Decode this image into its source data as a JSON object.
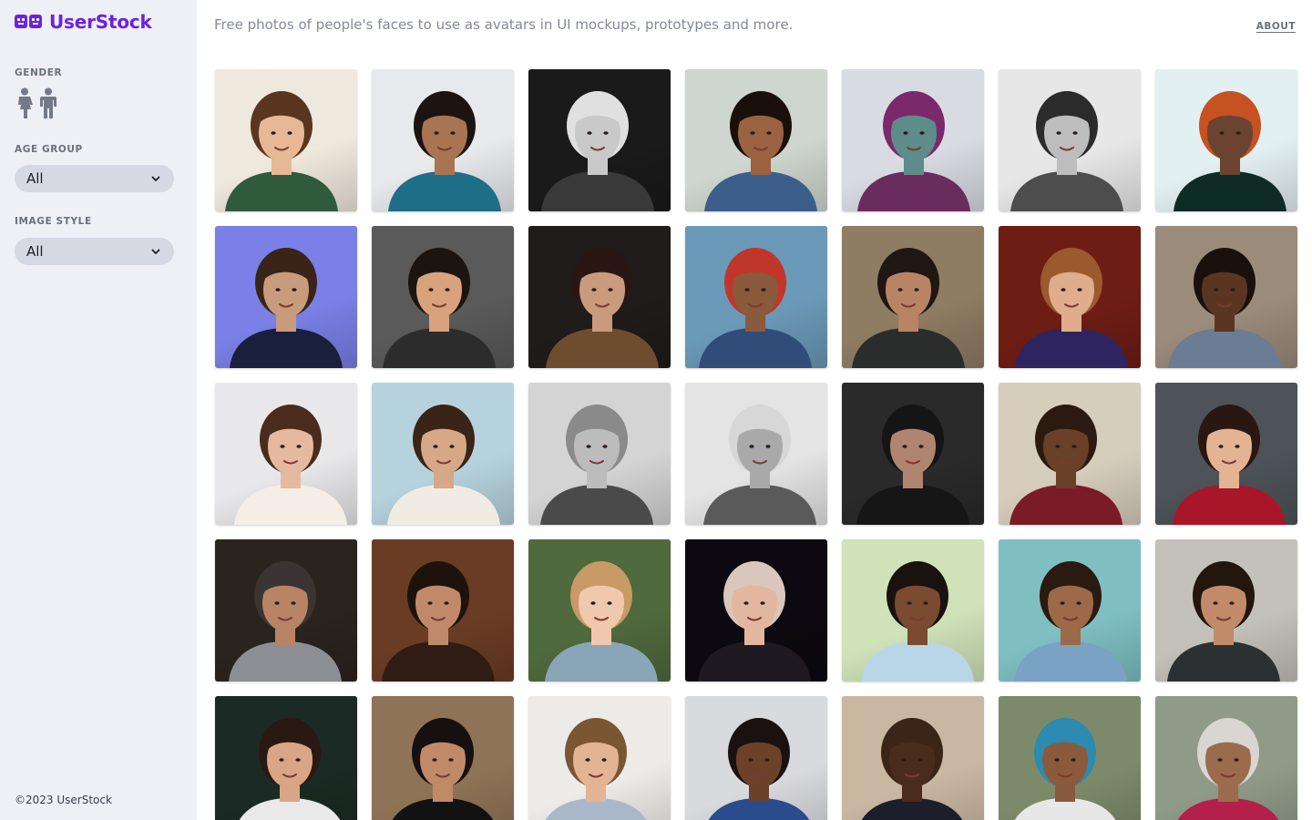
{
  "brand": {
    "name": "UserStock",
    "accent": "#6c22e0",
    "icon": "robot-logo-icon"
  },
  "header": {
    "tagline": "Free photos of people's faces to use as avatars in UI mockups, prototypes and more.",
    "about_link": "ABOUT"
  },
  "sidebar": {
    "gender_label": "GENDER",
    "gender_icons": [
      "female-person-icon",
      "male-person-icon"
    ],
    "age_group_label": "AGE GROUP",
    "age_group_value": "All",
    "image_style_label": "IMAGE STYLE",
    "image_style_value": "All",
    "footer": "©2023 UserStock"
  },
  "colors": {
    "sidebar_bg": "#eef0f6",
    "select_bg": "#d6d9e3",
    "muted_text": "#868a95"
  },
  "photos": [
    {
      "bg": "#efe8dd",
      "skin": "#e7b895",
      "hair": "#5a3520",
      "shirt": "#2f5a3c"
    },
    {
      "bg": "#e8e9ec",
      "skin": "#a87452",
      "hair": "#1c1410",
      "shirt": "#1f6e88"
    },
    {
      "bg": "#1a1a1a",
      "skin": "#c9c9c9",
      "hair": "#e0e0e0",
      "shirt": "#3a3a3a"
    },
    {
      "bg": "#cfd5cf",
      "skin": "#9a6241",
      "hair": "#1a100b",
      "shirt": "#3b5f8a"
    },
    {
      "bg": "#d9dbe3",
      "skin": "#5e8c8a",
      "hair": "#7a2a6a",
      "shirt": "#6a2c5d"
    },
    {
      "bg": "#e7e7e7",
      "skin": "#bdbdbd",
      "hair": "#2b2b2b",
      "shirt": "#4d4d4d"
    },
    {
      "bg": "#e3f0f2",
      "skin": "#6a4430",
      "hair": "#c65222",
      "shirt": "#0f2b26"
    },
    {
      "bg": "#7a80e6",
      "skin": "#c99b7d",
      "hair": "#3a2418",
      "shirt": "#18203c"
    },
    {
      "bg": "#5a5a5a",
      "skin": "#d8a27c",
      "hair": "#1b1512",
      "shirt": "#2c2c2c"
    },
    {
      "bg": "#1f1c1b",
      "skin": "#c99a7c",
      "hair": "#2a1713",
      "shirt": "#6e4d2f"
    },
    {
      "bg": "#6b99b8",
      "skin": "#8a5a3c",
      "hair": "#c0362b",
      "shirt": "#2f4d78"
    },
    {
      "bg": "#8e7c63",
      "skin": "#b88463",
      "hair": "#201612",
      "shirt": "#2a2d2c"
    },
    {
      "bg": "#6e1d14",
      "skin": "#dfac8c",
      "hair": "#9a5a2e",
      "shirt": "#2e2560"
    },
    {
      "bg": "#9b8b7b",
      "skin": "#5a3622",
      "hair": "#1a110c",
      "shirt": "#6b7d94"
    },
    {
      "bg": "#e8e8ea",
      "skin": "#e5b9a0",
      "hair": "#4a2c1d",
      "shirt": "#f4eee6"
    },
    {
      "bg": "#b6d3dd",
      "skin": "#d6a886",
      "hair": "#3a2418",
      "shirt": "#f1ece3"
    },
    {
      "bg": "#d4d4d4",
      "skin": "#bcbcbc",
      "hair": "#8a8a8a",
      "shirt": "#4a4a4a"
    },
    {
      "bg": "#e4e4e4",
      "skin": "#a9a9a9",
      "hair": "#d7d7d7",
      "shirt": "#5a5a5a"
    },
    {
      "bg": "#2a2a2a",
      "skin": "#b08570",
      "hair": "#151515",
      "shirt": "#161616"
    },
    {
      "bg": "#d7cdbd",
      "skin": "#6a4028",
      "hair": "#2a1a10",
      "shirt": "#7a1b27"
    },
    {
      "bg": "#4d5358",
      "skin": "#e3b393",
      "hair": "#2b1711",
      "shirt": "#a9162a"
    },
    {
      "bg": "#2a241f",
      "skin": "#b88465",
      "hair": "#3a3533",
      "shirt": "#8c8e93"
    },
    {
      "bg": "#6a3c24",
      "skin": "#c08a6a",
      "hair": "#1e120c",
      "shirt": "#2f1c14"
    },
    {
      "bg": "#4f6a3c",
      "skin": "#f0c8ae",
      "hair": "#c79a66",
      "shirt": "#8aa4b8"
    },
    {
      "bg": "#0c0a10",
      "skin": "#e3b6a0",
      "hair": "#d9c7bd",
      "shirt": "#1f1a22"
    },
    {
      "bg": "#cfe2b8",
      "skin": "#7a4b30",
      "hair": "#1a120e",
      "shirt": "#b9d6e8"
    },
    {
      "bg": "#7fbfc2",
      "skin": "#9c6a48",
      "hair": "#2a1a10",
      "shirt": "#7aa2c2"
    },
    {
      "bg": "#c3c1b9",
      "skin": "#c18b69",
      "hair": "#22160f",
      "shirt": "#2d3032"
    },
    {
      "bg": "#1b2a24",
      "skin": "#d8a685",
      "hair": "#2a1813",
      "shirt": "#e9e9e9"
    },
    {
      "bg": "#8f7356",
      "skin": "#c08a68",
      "hair": "#161010",
      "shirt": "#121212"
    },
    {
      "bg": "#ecebe8",
      "skin": "#e2b494",
      "hair": "#7a5632",
      "shirt": "#aab7c8"
    },
    {
      "bg": "#d8dadd",
      "skin": "#6b4129",
      "hair": "#1a1210",
      "shirt": "#2a4c8c"
    },
    {
      "bg": "#c9b7a2",
      "skin": "#4a2c1c",
      "hair": "#3a2516",
      "shirt": "#1d1e2c"
    },
    {
      "bg": "#7d8a6a",
      "skin": "#8a5a3c",
      "hair": "#2d8ab0",
      "shirt": "#e7e7e7"
    },
    {
      "bg": "#8f9a88",
      "skin": "#9a6b4d",
      "hair": "#d9d5d0",
      "shirt": "#b3204a"
    }
  ]
}
